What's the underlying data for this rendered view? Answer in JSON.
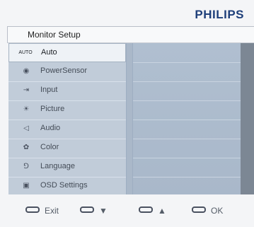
{
  "brand": "PHILIPS",
  "header": {
    "title": "Monitor Setup"
  },
  "menu": {
    "items": [
      {
        "icon": "auto-icon",
        "icon_text": "AUTO",
        "label": "Auto",
        "selected": true
      },
      {
        "icon": "powersensor-icon",
        "icon_text": "◉",
        "label": "PowerSensor",
        "selected": false
      },
      {
        "icon": "input-icon",
        "icon_text": "⇥",
        "label": "Input",
        "selected": false
      },
      {
        "icon": "picture-icon",
        "icon_text": "☀",
        "label": "Picture",
        "selected": false
      },
      {
        "icon": "audio-icon",
        "icon_text": "◁",
        "label": "Audio",
        "selected": false
      },
      {
        "icon": "color-icon",
        "icon_text": "✿",
        "label": "Color",
        "selected": false
      },
      {
        "icon": "language-icon",
        "icon_text": "⅁",
        "label": "Language",
        "selected": false
      },
      {
        "icon": "osd-settings-icon",
        "icon_text": "▣",
        "label": "OSD Settings",
        "selected": false
      }
    ]
  },
  "footer": {
    "exit_label": "Exit",
    "down_label": "▼",
    "up_label": "▲",
    "ok_label": "OK"
  }
}
